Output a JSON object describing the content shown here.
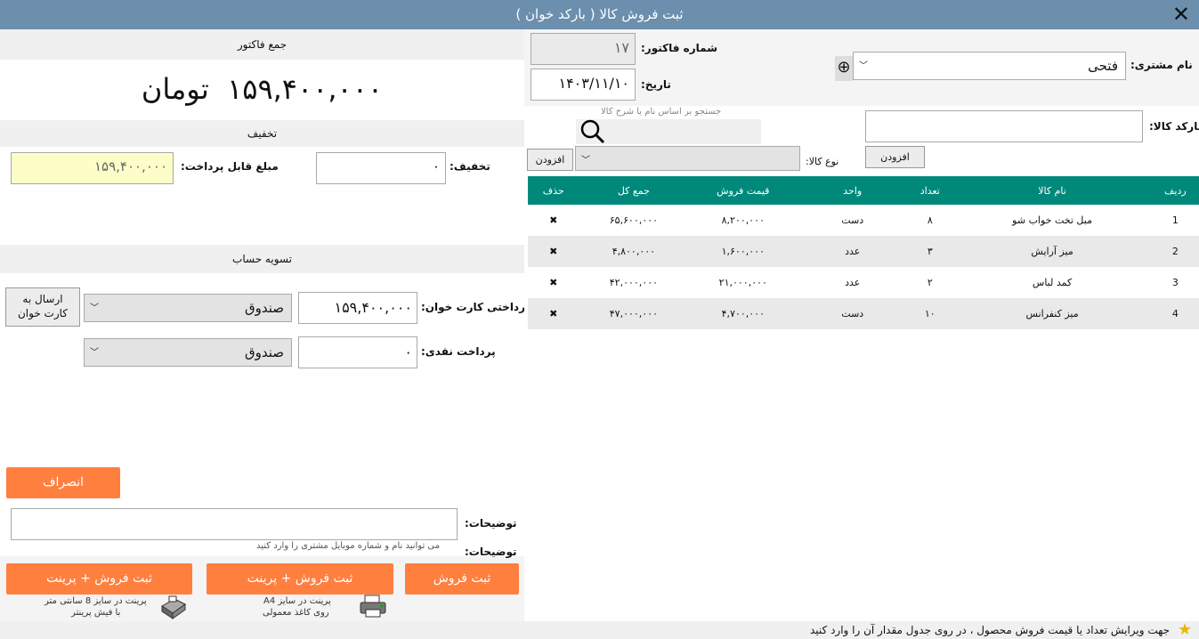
{
  "window": {
    "title": "ثبت فروش کالا ( بارکد خوان )",
    "close": "✕"
  },
  "summary": {
    "header": "جمع فاکتور",
    "total": "۱۵۹,۴۰۰,۰۰۰  تومان"
  },
  "discount": {
    "header": "تخفیف",
    "discount_label": "تخفیف:",
    "discount_value": "۰",
    "payable_label": "مبلغ قابل پرداخت:",
    "payable_value": "۱۵۹,۴۰۰,۰۰۰"
  },
  "settlement": {
    "header": "تسویه حساب",
    "card_label": "پرداختی کارت خوان:",
    "card_value": "۱۵۹,۴۰۰,۰۰۰",
    "card_account": "صندوق",
    "send_card_button": "ارسال به کارت خوان",
    "cash_label": "پرداخت نقدی:",
    "cash_value": "۰",
    "cash_account": "صندوق"
  },
  "cancel_button": "انصراف",
  "notes": {
    "label": "توضیحات:",
    "hint": "می توانید نام و شماره موبایل مشتری را وارد کنید"
  },
  "actions": {
    "save": "ثبت فروش",
    "save_print_a4": "ثبت فروش + پرینت",
    "a4_caption_1": "پرینت در سایز A4",
    "a4_caption_2": "روی کاغذ معمولی",
    "save_print_8cm": "ثبت فروش + پرینت",
    "cm8_caption_1": "پرینت در سایز 8 سانتی متر",
    "cm8_caption_2": "با فیش پرینتر"
  },
  "invoice": {
    "customer_label": "نام مشتری:",
    "customer_value": "فتحی",
    "add_customer_icon": "⊕",
    "number_label": "شماره فاکتور:",
    "number_value": "۱۷",
    "date_label": "تاریخ:",
    "date_value": "۱۴۰۳/۱۱/۱۰"
  },
  "product": {
    "barcode_label": "بارکد کالا:",
    "search_hint": "جستجو بر اساس نام یا شرح کالا",
    "add_button": "افزودن",
    "type_label": "نوع کالا:",
    "type_add_button": "افزودن"
  },
  "table": {
    "headers": {
      "row": "ردیف",
      "name": "نام کالا",
      "qty": "تعداد",
      "unit": "واحد",
      "price": "قیمت فروش",
      "total": "جمع کل",
      "delete": "حذف"
    },
    "rows": [
      {
        "row": "1",
        "name": "مبل تخت خواب شو",
        "qty": "۸",
        "unit": "دست",
        "price": "۸,۲۰۰,۰۰۰",
        "total": "۶۵,۶۰۰,۰۰۰",
        "delete": "✖"
      },
      {
        "row": "2",
        "name": "میز آرایش",
        "qty": "۳",
        "unit": "عدد",
        "price": "۱,۶۰۰,۰۰۰",
        "total": "۴,۸۰۰,۰۰۰",
        "delete": "✖"
      },
      {
        "row": "3",
        "name": "کمد لباس",
        "qty": "۲",
        "unit": "عدد",
        "price": "۲۱,۰۰۰,۰۰۰",
        "total": "۴۲,۰۰۰,۰۰۰",
        "delete": "✖"
      },
      {
        "row": "4",
        "name": "میز کنفرانس",
        "qty": "۱۰",
        "unit": "دست",
        "price": "۴,۷۰۰,۰۰۰",
        "total": "۴۷,۰۰۰,۰۰۰",
        "delete": "✖"
      }
    ]
  },
  "status": {
    "hint": "جهت ویرایش تعداد یا قیمت فروش محصول ، در روی جدول مقدار آن را وارد کنید",
    "icon": "★"
  }
}
